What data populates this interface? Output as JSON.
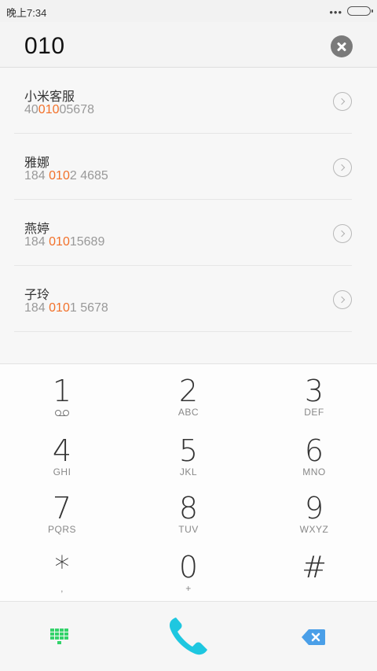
{
  "status_bar": {
    "time": "晚上7:34",
    "dots": "•••"
  },
  "search": {
    "query": "010"
  },
  "results": [
    {
      "name": "小米客服",
      "number_pre": "40",
      "number_match": "010",
      "number_post": "05678"
    },
    {
      "name": "雅娜",
      "number_pre": "184 ",
      "number_match": "010",
      "number_post": "2 4685"
    },
    {
      "name": "燕婷",
      "number_pre": "184 ",
      "number_match": "010",
      "number_post": "15689"
    },
    {
      "name": "子玲",
      "number_pre": "184 ",
      "number_match": "010",
      "number_post": "1 5678"
    }
  ],
  "keys": [
    {
      "digit": "1",
      "letters": ""
    },
    {
      "digit": "2",
      "letters": "ABC"
    },
    {
      "digit": "3",
      "letters": "DEF"
    },
    {
      "digit": "4",
      "letters": "GHI"
    },
    {
      "digit": "5",
      "letters": "JKL"
    },
    {
      "digit": "6",
      "letters": "MNO"
    },
    {
      "digit": "7",
      "letters": "PQRS"
    },
    {
      "digit": "8",
      "letters": "TUV"
    },
    {
      "digit": "9",
      "letters": "WXYZ"
    },
    {
      "digit": "*",
      "letters": ","
    },
    {
      "digit": "0",
      "letters": "+"
    },
    {
      "digit": "#",
      "letters": ""
    }
  ],
  "actions": {
    "dialpad_icon": "dialpad-grid-icon",
    "call_icon": "phone-handset-icon",
    "backspace_icon": "backspace-icon"
  },
  "colors": {
    "highlight": "#f2712a",
    "dialpad_icon": "#34d36b",
    "call": "#1ec7e0",
    "backspace": "#4a9fe8"
  }
}
